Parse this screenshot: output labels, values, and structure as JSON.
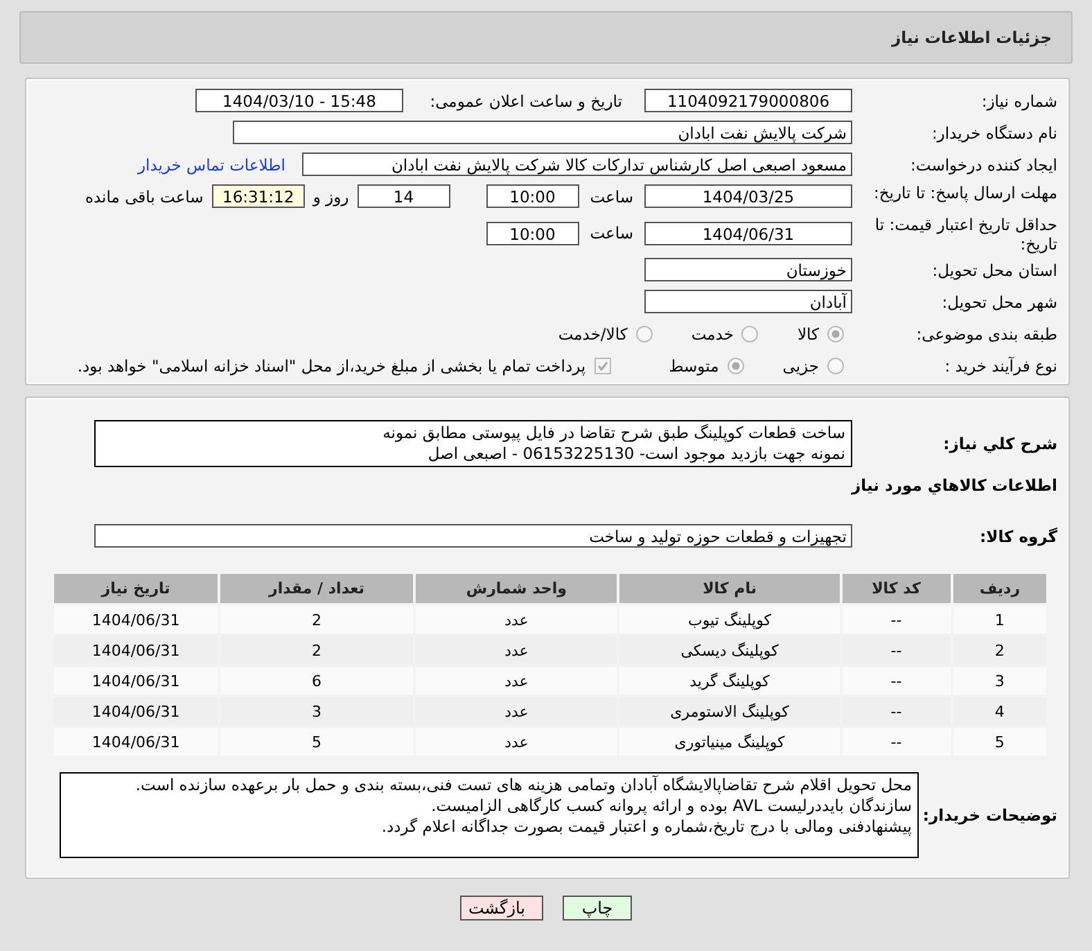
{
  "page_title": "جزئیات اطلاعات نیاز",
  "need_number": {
    "label": "شماره نیاز:",
    "value": "1104092179000806"
  },
  "announce": {
    "label": "تاریخ و ساعت اعلان عمومی:",
    "value": "1404/03/10 - 15:48"
  },
  "buyer": {
    "label": "نام دستگاه خریدار:",
    "value": "شرکت پالایش نفت ابادان"
  },
  "creator": {
    "label": "ایجاد کننده درخواست:",
    "value": "مسعود اصبعی اصل کارشناس تدارکات کالا  شرکت پالایش نفت ابادان",
    "link": "اطلاعات تماس خریدار"
  },
  "reply_deadline": {
    "label": "مهلت ارسال پاسخ: تا تاریخ:",
    "date": "1404/03/25",
    "time_label": "ساعت",
    "time": "10:00",
    "days": "14",
    "days_label": "روز و",
    "remaining": "16:31:12",
    "remaining_label": "ساعت باقی مانده"
  },
  "price_validity": {
    "label": "حداقل تاریخ اعتبار قیمت: تا تاریخ:",
    "date": "1404/06/31",
    "time_label": "ساعت",
    "time": "10:00"
  },
  "province": {
    "label": "استان محل تحویل:",
    "value": "خوزستان"
  },
  "city": {
    "label": "شهر محل تحویل:",
    "value": "آبادان"
  },
  "category": {
    "label": "طبقه بندی موضوعی:",
    "options": [
      {
        "label": "کالا",
        "selected": true
      },
      {
        "label": "خدمت",
        "selected": false
      },
      {
        "label": "کالا/خدمت",
        "selected": false
      }
    ]
  },
  "purchase_type": {
    "label": "نوع فرآیند خرید :",
    "options": [
      {
        "label": "جزیی",
        "selected": false
      },
      {
        "label": "متوسط",
        "selected": true
      }
    ],
    "treasury": {
      "label": "پرداخت تمام یا بخشی از مبلغ خرید،از محل \"اسناد خزانه اسلامی\" خواهد بود.",
      "checked": true
    }
  },
  "summary": {
    "label": "شرح کلي نياز:",
    "text": "ساخت قطعات کوپلینگ طبق شرح تقاضا در فایل پیوستی مطابق نمونه\nنمونه جهت بازدید موجود است- 06153225130 - اصبعی اصل"
  },
  "goods_heading": "اطلاعات کالاهاي مورد نياز",
  "goods_group": {
    "label": "گروه کالا:",
    "value": "تجهیزات و قطعات حوزه تولید و ساخت"
  },
  "table": {
    "columns": [
      "ردیف",
      "کد کالا",
      "نام کالا",
      "واحد شمارش",
      "تعداد / مقدار",
      "تاریخ نیاز"
    ],
    "rows": [
      [
        "1",
        "--",
        "کوپلینگ تیوب",
        "عدد",
        "2",
        "1404/06/31"
      ],
      [
        "2",
        "--",
        "کوپلینگ دیسکی",
        "عدد",
        "2",
        "1404/06/31"
      ],
      [
        "3",
        "--",
        "کوپلینگ گرید",
        "عدد",
        "6",
        "1404/06/31"
      ],
      [
        "4",
        "--",
        "کوپلینگ الاستومری",
        "عدد",
        "3",
        "1404/06/31"
      ],
      [
        "5",
        "--",
        "کوپلینگ مینیاتوری",
        "عدد",
        "5",
        "1404/06/31"
      ]
    ]
  },
  "buyer_notes": {
    "label": "توضیحات خریدار:",
    "text": "محل تحویل اقلام شرح تقاضاپالایشگاه آبادان وتمامی هزینه های تست فنی،بسته بندی و حمل بار برعهده سازنده است.\nسازندگان بایددرلیست AVL بوده و ارائه پروانه کسب کارگاهی الزامیست.\nپیشنهادفنی ومالی با درج تاریخ،شماره و اعتبار قیمت بصورت جداگانه اعلام گردد."
  },
  "buttons": [
    {
      "label": "چاپ",
      "kind": "print"
    },
    {
      "label": "بازگشت",
      "kind": "back"
    }
  ]
}
